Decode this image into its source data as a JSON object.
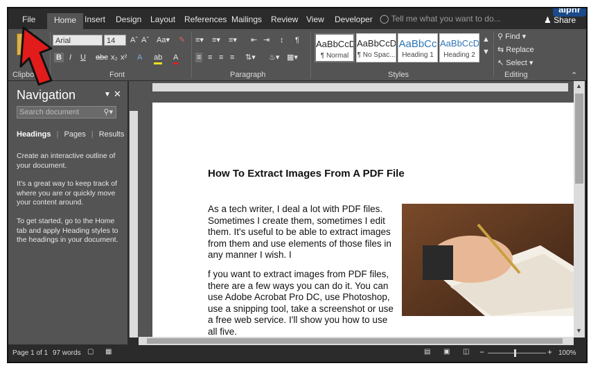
{
  "watermark": "alphr",
  "tabs": [
    "File",
    "Home",
    "Insert",
    "Design",
    "Layout",
    "References",
    "Mailings",
    "Review",
    "View",
    "Developer"
  ],
  "tell_me": "Tell me what you want to do...",
  "share": "Share",
  "ribbon": {
    "clipboard_label": "Clipboard",
    "font_label": "Font",
    "paragraph_label": "Paragraph",
    "styles_label": "Styles",
    "editing_label": "Editing",
    "font_name": "Arial",
    "font_size": "14",
    "styles": [
      {
        "sample": "AaBbCcD",
        "name": "¶ Normal"
      },
      {
        "sample": "AaBbCcD",
        "name": "¶ No Spac..."
      },
      {
        "sample": "AaBbCc",
        "name": "Heading 1"
      },
      {
        "sample": "AaBbCcD",
        "name": "Heading 2"
      }
    ],
    "find": "Find",
    "replace": "Replace",
    "select": "Select"
  },
  "nav": {
    "title": "Navigation",
    "search_placeholder": "Search document",
    "tab_headings": "Headings",
    "tab_pages": "Pages",
    "tab_results": "Results",
    "p1": "Create an interactive outline of your document.",
    "p2": "It's a great way to keep track of where you are or quickly move your content around.",
    "p3": "To get started, go to the Home tab and apply Heading styles to the headings in your document."
  },
  "document": {
    "title": "How To Extract Images From A PDF File",
    "para1": "As a tech writer, I deal a lot with PDF files. Sometimes I create them, sometimes I edit them. It's useful to be able to extract images from them and use elements of those files in any manner I wish. I",
    "para2": "f you want to extract images from PDF files, there are a few ways you can do it. You can use Adobe Acrobat Pro DC, use Photoshop, use a snipping tool, take a screenshot or use a free web service. I'll show you how to use all five."
  },
  "status": {
    "page": "Page 1 of 1",
    "words": "97 words",
    "zoom": "100%"
  }
}
